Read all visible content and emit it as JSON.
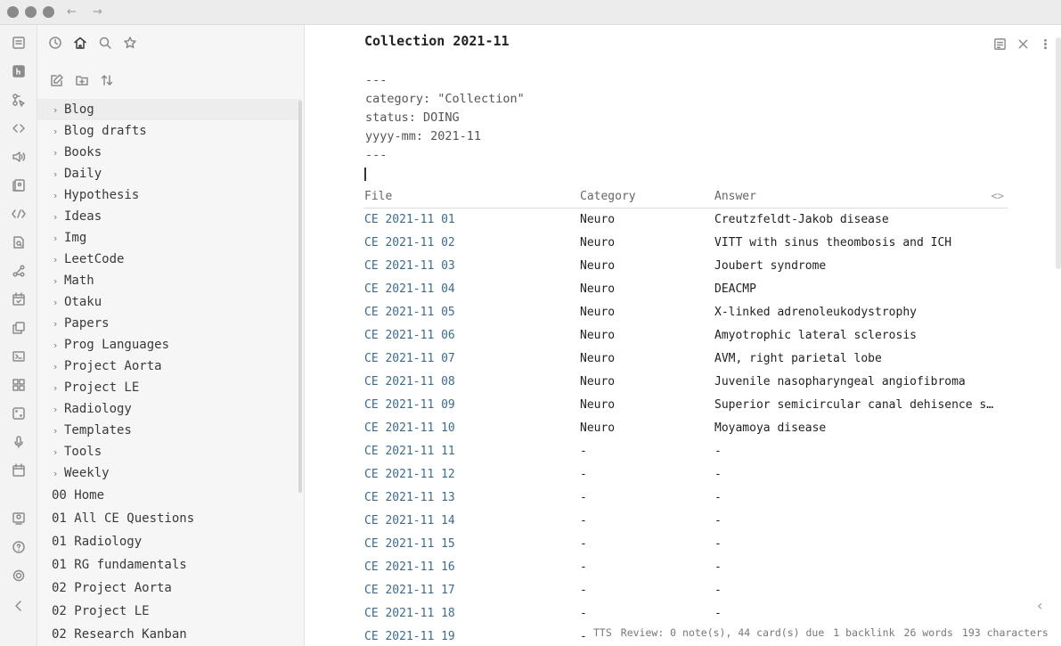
{
  "titlebar": {
    "back": "←",
    "forward": "→"
  },
  "sidebar": {
    "folders": [
      "Blog",
      "Blog drafts",
      "Books",
      "Daily",
      "Hypothesis",
      "Ideas",
      "Img",
      "LeetCode",
      "Math",
      "Otaku",
      "Papers",
      "Prog Languages",
      "Project Aorta",
      "Project LE",
      "Radiology",
      "Templates",
      "Tools",
      "Weekly"
    ],
    "files": [
      "00 Home",
      "01 All CE Questions",
      "01 Radiology",
      "01 RG fundamentals",
      "02 Project Aorta",
      "02 Project LE",
      "02 Research Kanban"
    ]
  },
  "document": {
    "title": "Collection 2021-11",
    "frontmatter": [
      "---",
      "category: \"Collection\"",
      "status: DOING",
      "yyyy-mm: 2021-11",
      "---"
    ],
    "table": {
      "headers": [
        "File",
        "Category",
        "Answer"
      ],
      "code_toggle": "<>",
      "rows": [
        [
          "CE 2021-11 01",
          "Neuro",
          "Creutzfeldt-Jakob disease"
        ],
        [
          "CE 2021-11 02",
          "Neuro",
          "VITT with sinus theombosis and ICH"
        ],
        [
          "CE 2021-11 03",
          "Neuro",
          "Joubert syndrome"
        ],
        [
          "CE 2021-11 04",
          "Neuro",
          "DEACMP"
        ],
        [
          "CE 2021-11 05",
          "Neuro",
          "X-linked adrenoleukodystrophy"
        ],
        [
          "CE 2021-11 06",
          "Neuro",
          "Amyotrophic lateral sclerosis"
        ],
        [
          "CE 2021-11 07",
          "Neuro",
          "AVM, right parietal lobe"
        ],
        [
          "CE 2021-11 08",
          "Neuro",
          "Juvenile nasopharyngeal angiofibroma"
        ],
        [
          "CE 2021-11 09",
          "Neuro",
          "Superior semicircular canal dehisence sy…"
        ],
        [
          "CE 2021-11 10",
          "Neuro",
          "Moyamoya disease"
        ],
        [
          "CE 2021-11 11",
          "-",
          "-"
        ],
        [
          "CE 2021-11 12",
          "-",
          "-"
        ],
        [
          "CE 2021-11 13",
          "-",
          "-"
        ],
        [
          "CE 2021-11 14",
          "-",
          "-"
        ],
        [
          "CE 2021-11 15",
          "-",
          "-"
        ],
        [
          "CE 2021-11 16",
          "-",
          "-"
        ],
        [
          "CE 2021-11 17",
          "-",
          "-"
        ],
        [
          "CE 2021-11 18",
          "-",
          "-"
        ],
        [
          "CE 2021-11 19",
          "-",
          "-"
        ]
      ]
    }
  },
  "statusbar": {
    "tts": "TTS",
    "review": "Review: 0 note(s), 44 card(s) due",
    "backlinks": "1 backlink",
    "words": "26 words",
    "characters": "193 characters"
  },
  "icons": {
    "ribbon": [
      "file-explorer-icon",
      "hover-editor-icon",
      "graph-cursor-icon",
      "code-icon",
      "tts-speaker-icon",
      "flashcards-icon",
      "percent-icon",
      "search-file-icon",
      "graph-view-icon",
      "calendar-check-icon",
      "copy-icon",
      "terminal-icon",
      "grid-icon",
      "dice-icon",
      "microphone-icon",
      "calendar-icon",
      "vault-switch-icon",
      "help-icon",
      "settings-icon",
      "collapse-ribbon-icon"
    ],
    "sidebar_tabs": [
      "recent-files-icon",
      "home-icon",
      "search-icon",
      "starred-icon"
    ],
    "sidebar_actions": [
      "new-note-icon",
      "new-folder-icon",
      "sort-icon"
    ],
    "document_actions": [
      "reading-view-icon",
      "close-icon",
      "more-options-icon"
    ]
  }
}
